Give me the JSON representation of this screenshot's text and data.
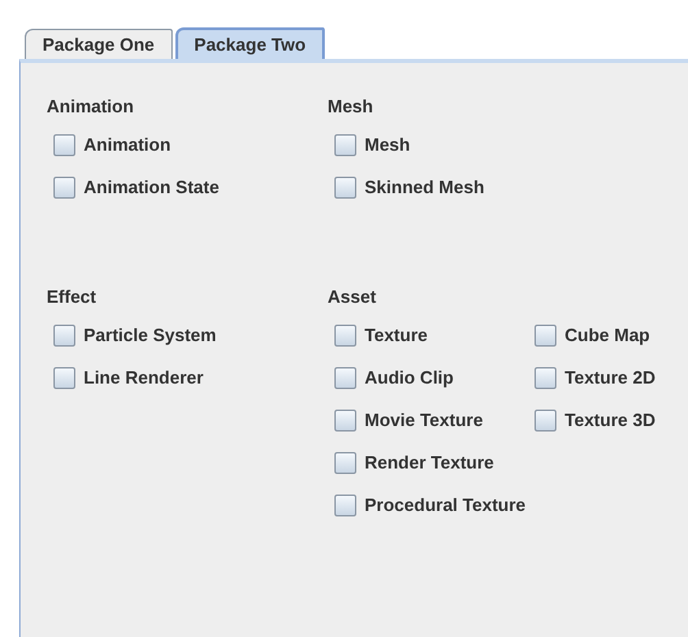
{
  "tabs": [
    {
      "label": "Package One",
      "selected": false
    },
    {
      "label": "Package Two",
      "selected": true
    }
  ],
  "groups": [
    {
      "title": "Animation",
      "columns": [
        [
          {
            "label": "Animation",
            "checked": false
          },
          {
            "label": "Animation State",
            "checked": false
          }
        ]
      ]
    },
    {
      "title": "Mesh",
      "columns": [
        [
          {
            "label": "Mesh",
            "checked": false
          },
          {
            "label": "Skinned Mesh",
            "checked": false
          }
        ]
      ]
    },
    {
      "title": "Effect",
      "columns": [
        [
          {
            "label": "Particle System",
            "checked": false
          },
          {
            "label": "Line Renderer",
            "checked": false
          }
        ]
      ]
    },
    {
      "title": "Asset",
      "columns": [
        [
          {
            "label": "Texture",
            "checked": false
          },
          {
            "label": "Audio Clip",
            "checked": false
          },
          {
            "label": "Movie Texture",
            "checked": false
          },
          {
            "label": "Render Texture",
            "checked": false
          },
          {
            "label": "Procedural Texture",
            "checked": false
          }
        ],
        [
          {
            "label": "Cube Map",
            "checked": false
          },
          {
            "label": "Texture 2D",
            "checked": false
          },
          {
            "label": "Texture 3D",
            "checked": false
          }
        ]
      ]
    }
  ]
}
